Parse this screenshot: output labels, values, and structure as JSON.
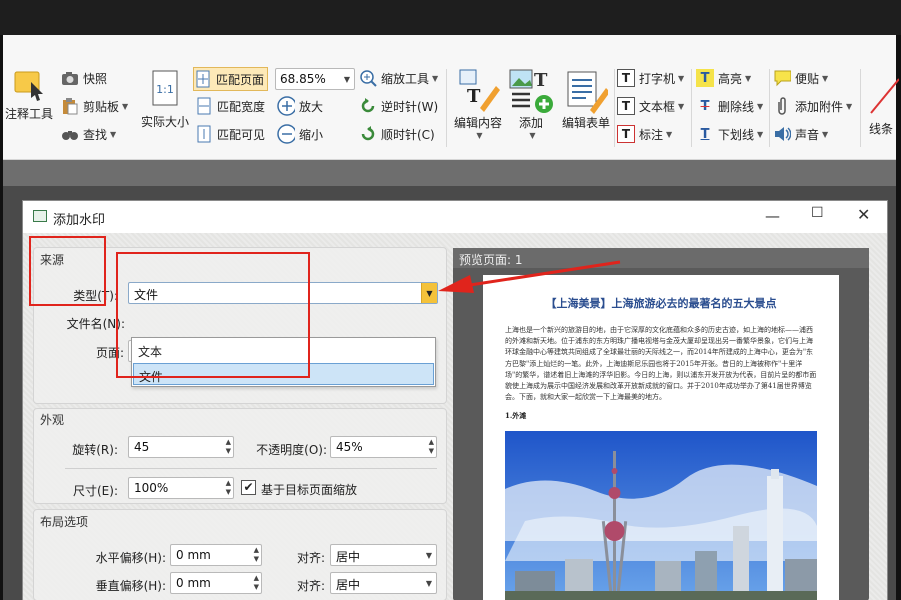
{
  "ribbon": {
    "group1": {
      "label": "注释工具"
    },
    "snapshot": "快照",
    "clipboard": "剪贴板",
    "find": "查找",
    "actual_size": "实际大小",
    "fit_page": "匹配页面",
    "fit_width": "匹配宽度",
    "fit_visible": "匹配可见",
    "zoom_value": "68.85%",
    "zoom_tool": "缩放工具",
    "zoom_in": "放大",
    "zoom_out": "缩小",
    "rotate_ccw": "逆时针(W)",
    "rotate_cw": "顺时针(C)",
    "edit_content": "编辑内容",
    "add": "添加",
    "edit_form": "编辑表单",
    "typewriter": "打字机",
    "textbox": "文本框",
    "callout": "标注",
    "highlight": "高亮",
    "strikeout": "删除线",
    "underline": "下划线",
    "note": "便贴",
    "attach": "添加附件",
    "sound": "声音",
    "line": "线条"
  },
  "dialog": {
    "title": "添加水印",
    "source": {
      "heading": "来源",
      "type_label": "类型(T):",
      "type_value": "文件",
      "filename_label": "文件名(N):",
      "page_label": "页面:",
      "options": [
        "文本",
        "文件"
      ]
    },
    "appearance": {
      "heading": "外观",
      "rotation_label": "旋转(R):",
      "rotation_value": "45",
      "opacity_label": "不透明度(O):",
      "opacity_value": "45%",
      "size_label": "尺寸(E):",
      "size_value": "100%",
      "scale_checkbox": "基于目标页面缩放"
    },
    "layout": {
      "heading": "布局选项",
      "h_offset_label": "水平偏移(H):",
      "h_offset_value": "0 mm",
      "v_offset_label": "垂直偏移(H):",
      "v_offset_value": "0 mm",
      "align_label": "对齐:",
      "h_align_value": "居中",
      "v_align_value": "居中"
    },
    "preview": {
      "heading": "预览页面: 1",
      "doc_title": "【上海美景】上海旅游必去的最著名的五大景点",
      "doc_para": "上海也是一个新兴的旅游目的地，由于它深厚的文化底蕴和众多的历史古迹，如上海的地标——浦西的外滩和新天地。位于浦东的东方明珠广播电视塔与金茂大厦却呈现出另一番繁华景象，它们与上海环球金融中心等建筑共同组成了全球最壮丽的天际线之一，而2014年所建成的上海中心，更会为\"东方巴黎\"添上灿烂的一笔。此外，上海迪斯尼乐园也将于2015年开张。昔日的上海被称作\"十里洋场\"的繁华，谱述着旧上海滩的浮华旧影。今日的上海，则以浦东开发开放为代表，目前片呈的都市面貌使上海成为展示中国经济发展和改革开放新成就的窗口。并于2010年成功举办了第41届世界博览会。下面，就和大家一起欣赏一下上海最美的地方。",
      "doc_subhead": "1.外滩"
    }
  }
}
